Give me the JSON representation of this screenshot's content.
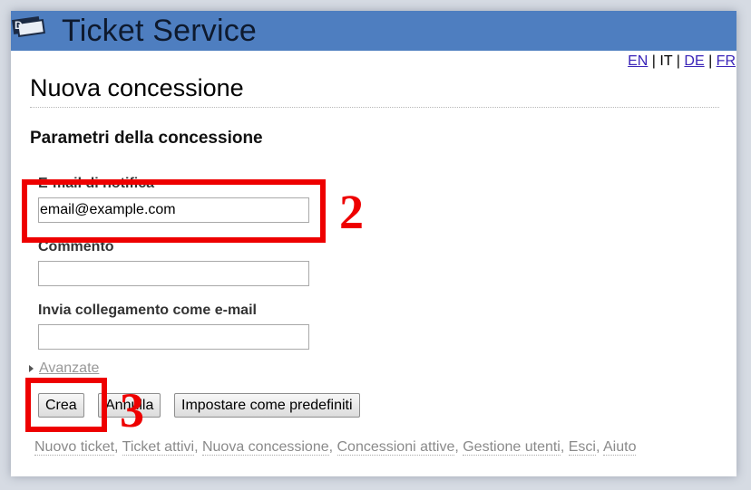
{
  "app": {
    "title": "Ticket Service"
  },
  "languages": {
    "items": [
      {
        "code": "EN",
        "active": false
      },
      {
        "code": "IT",
        "active": true
      },
      {
        "code": "DE",
        "active": false
      },
      {
        "code": "FR",
        "active": false
      }
    ],
    "separator": " | "
  },
  "page": {
    "title": "Nuova concessione",
    "section_title": "Parametri della concessione"
  },
  "form": {
    "email": {
      "label": "E-mail di notifica",
      "value": "email@example.com"
    },
    "comment": {
      "label": "Commento",
      "value": ""
    },
    "send_link": {
      "label": "Invia collegamento come e-mail",
      "value": ""
    },
    "advanced_label": "Avanzate"
  },
  "buttons": {
    "create": "Crea",
    "cancel": "Annulla",
    "set_default": "Impostare come predefiniti"
  },
  "footer": {
    "links": [
      "Nuovo ticket",
      "Ticket attivi",
      "Nuova concessione",
      "Concessioni attive",
      "Gestione utenti",
      "Esci",
      "Aiuto"
    ]
  },
  "annotations": {
    "step_2": "2",
    "step_3": "3",
    "color": "#ee0000"
  },
  "colors": {
    "header": "#4e7ec0",
    "link": "#3a24b8",
    "annotation": "#ee0000"
  }
}
